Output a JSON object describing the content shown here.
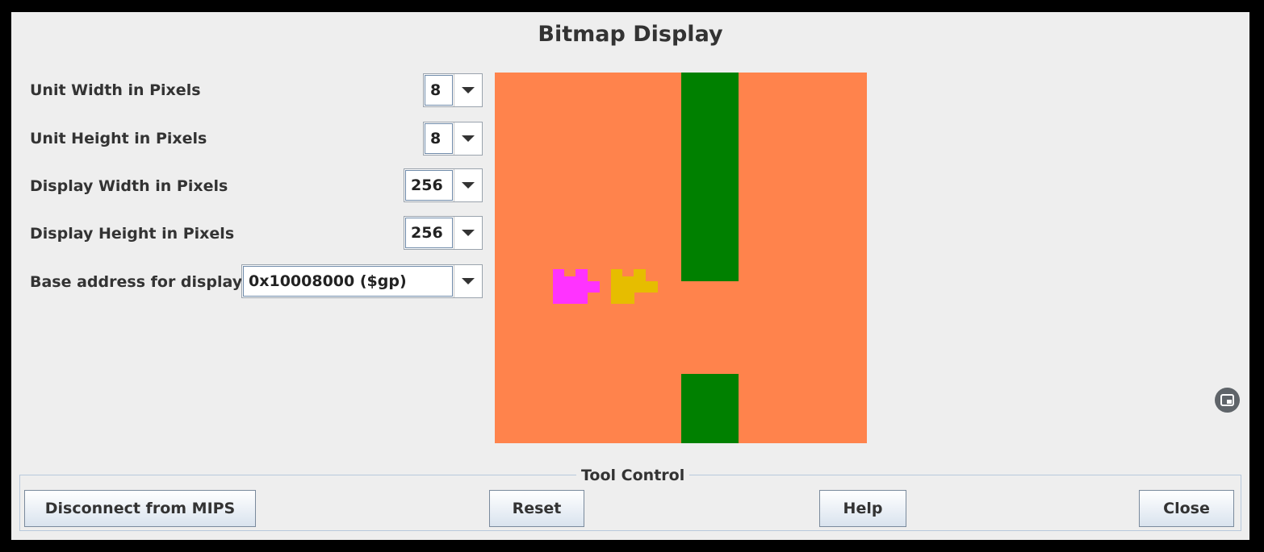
{
  "window": {
    "title": "Bitmap Display"
  },
  "settings": {
    "unit_width": {
      "label": "Unit Width in Pixels",
      "value": "8"
    },
    "unit_height": {
      "label": "Unit Height in Pixels",
      "value": "8"
    },
    "display_width": {
      "label": "Display Width in Pixels",
      "value": "256"
    },
    "display_height": {
      "label": "Display Height in Pixels",
      "value": "256"
    }
  },
  "base_address": {
    "label": "Base address for display",
    "value": "0x10008000 ($gp)"
  },
  "bitmap": {
    "grid_units": 32,
    "background_color": "#ff834c",
    "pipe_color": "#008000",
    "magenta_color": "#ff33ff",
    "yellow_color": "#e6bd00"
  },
  "tool_control": {
    "legend": "Tool Control",
    "disconnect_label": "Disconnect from MIPS",
    "reset_label": "Reset",
    "help_label": "Help",
    "close_label": "Close"
  },
  "icons": {
    "dropdown": "chevron-down-icon",
    "floating": "picture-in-picture-icon"
  }
}
